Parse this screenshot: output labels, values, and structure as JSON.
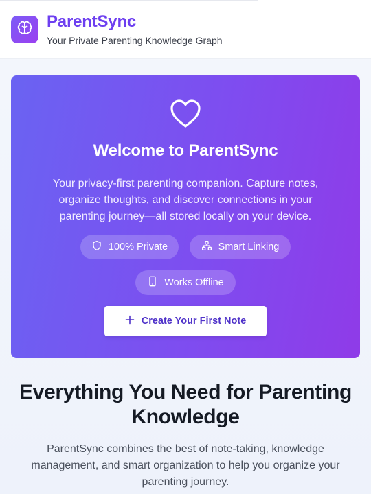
{
  "header": {
    "title": "ParentSync",
    "subtitle": "Your Private Parenting Knowledge Graph",
    "logo_icon": "brain-icon"
  },
  "hero": {
    "icon": "heart-icon",
    "title": "Welcome to ParentSync",
    "description": "Your privacy-first parenting companion. Capture notes, organize thoughts, and discover connections in your parenting journey—all stored locally on your device.",
    "chips": [
      {
        "label": "100% Private",
        "icon": "shield-icon"
      },
      {
        "label": "Smart Linking",
        "icon": "network-icon"
      },
      {
        "label": "Works Offline",
        "icon": "smartphone-icon"
      }
    ],
    "cta": {
      "label": "Create Your First Note",
      "icon": "plus-icon"
    },
    "gradient": [
      "#6a63f2",
      "#8f3be8"
    ]
  },
  "features": {
    "title": "Everything You Need for Parenting Knowledge",
    "description": "ParentSync combines the best of note-taking, knowledge management, and smart organization to help you organize your parenting journey."
  },
  "colors": {
    "brand": "#6d3ff0",
    "cta_text": "#4f32c9",
    "heading": "#151a24"
  }
}
